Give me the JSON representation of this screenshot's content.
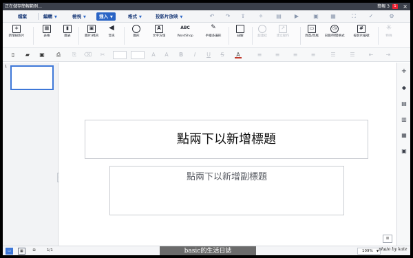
{
  "window": {
    "title": "正在儲存簡報範例…",
    "status": "簡報 3",
    "badge": "1",
    "close": "×"
  },
  "menu": {
    "items": [
      "檔案",
      "編輯",
      "檢視",
      "插入",
      "格式",
      "投影片放映"
    ],
    "active": "插入"
  },
  "ribbon": {
    "buttons": [
      "新增投影片",
      "表格",
      "圖表",
      "圖片/視訊",
      "音訊",
      "圖形",
      "文字方塊",
      "WordShop",
      "手繪多邊形",
      "註解",
      "超連結",
      "建立動作",
      "頁首/頁尾",
      "日期/時間格式",
      "投影片編號",
      "特殊"
    ],
    "wordshop_icon": "ABC"
  },
  "slide": {
    "title_placeholder": "點兩下以新增標題",
    "subtitle_placeholder": "點兩下以新增副標題",
    "thumbnail_number": "1"
  },
  "statusbar": {
    "page_count": "1/1",
    "zoom": "109%"
  },
  "watermark": {
    "text": "basic的生活日誌",
    "signature": "photo by kate"
  },
  "colors": {
    "accent": "#2a64c5",
    "titlebar": "#3a3f4a",
    "selected_thumb": "#3d77d8"
  }
}
